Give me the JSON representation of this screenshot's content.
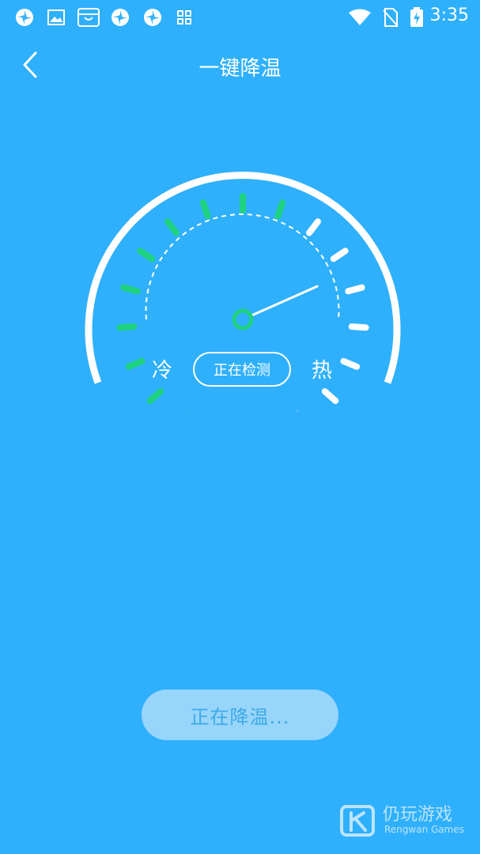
{
  "status_bar": {
    "time": "3:35",
    "left_icons": [
      "pinwheel-icon",
      "image-icon",
      "shop-bag-icon",
      "pinwheel-icon",
      "pinwheel-icon",
      "apps-grid-icon"
    ],
    "right_icons": [
      "wifi-icon",
      "no-sim-icon",
      "battery-charging-icon"
    ]
  },
  "header": {
    "title": "一键降温",
    "back_icon": "chevron-left-icon"
  },
  "gauge": {
    "cold_label": "冷",
    "hot_label": "热",
    "status_text": "正在检测",
    "needle_level": 0.72,
    "colors": {
      "cool_tick": "#1fd27f",
      "hot_tick": "#ffffff",
      "arc": "#ffffff"
    }
  },
  "action": {
    "button_label": "正在降温..."
  },
  "watermark": {
    "name_cn": "仍玩游戏",
    "name_en": "Rengwan Games"
  },
  "theme": {
    "background": "#2fb0fc",
    "button_bg": "#97d5fb",
    "button_text": "#3da9e6"
  }
}
